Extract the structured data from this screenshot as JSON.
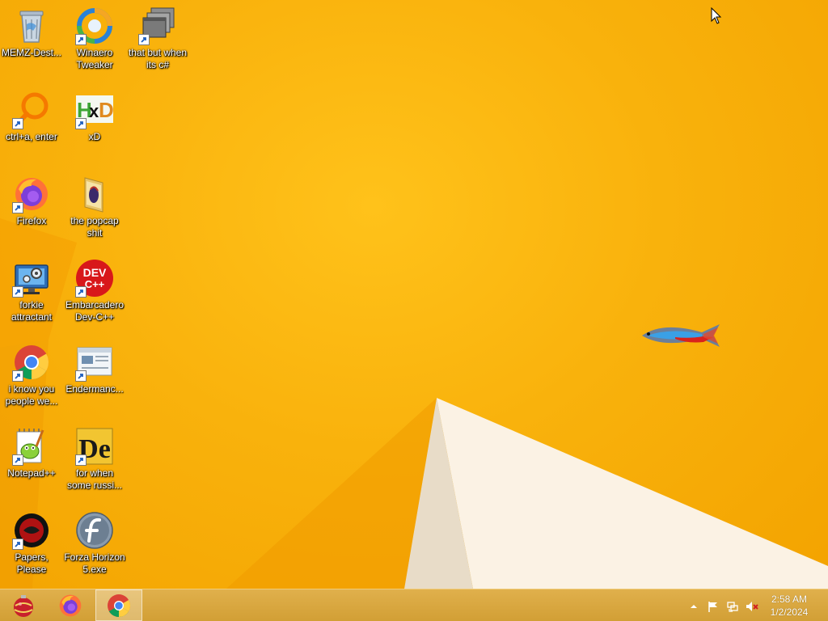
{
  "desktop": {
    "icons": [
      {
        "label": "MEMZ-Dest...",
        "icon": "recycle-bin-icon"
      },
      {
        "label": "Winaero Tweaker",
        "icon": "winaero-tweaker-icon"
      },
      {
        "label": "that but when its c#",
        "icon": "stacked-windows-icon"
      },
      {
        "label": "ctrl+a, enter",
        "icon": "magnifier-icon"
      },
      {
        "label": "xD",
        "icon": "hxd-icon"
      },
      {
        "label": "Firefox",
        "icon": "firefox-icon"
      },
      {
        "label": "the popcap shit",
        "icon": "folder-icon"
      },
      {
        "label": "forkie attractant",
        "icon": "monitor-gear-icon"
      },
      {
        "label": "Embarcadero Dev-C++",
        "icon": "dev-cpp-icon"
      },
      {
        "label": "i know you people we...",
        "icon": "chrome-icon"
      },
      {
        "label": "Endermanc...",
        "icon": "window-app-icon"
      },
      {
        "label": "Notepad++",
        "icon": "notepad-plus-plus-icon"
      },
      {
        "label": "for when some russi...",
        "icon": "de-icon"
      },
      {
        "label": "Papers, Please",
        "icon": "papers-please-icon"
      },
      {
        "label": "Forza Horizon 5.exe",
        "icon": "flash-icon"
      }
    ],
    "dev_cpp_text": {
      "line1": "DEV",
      "line2": "C++"
    },
    "hxd_text": "HxD",
    "de_text": "De"
  },
  "taskbar": {
    "pinned": [
      {
        "icon": "ornament-icon"
      },
      {
        "icon": "firefox-icon"
      },
      {
        "icon": "chrome-icon",
        "active": true
      }
    ],
    "clock": {
      "time": "2:58 AM",
      "date": "1/2/2024"
    }
  },
  "colors": {
    "wallpaper": "#f6a800",
    "taskbar": "#d9a640",
    "label_text": "#ffffff"
  }
}
